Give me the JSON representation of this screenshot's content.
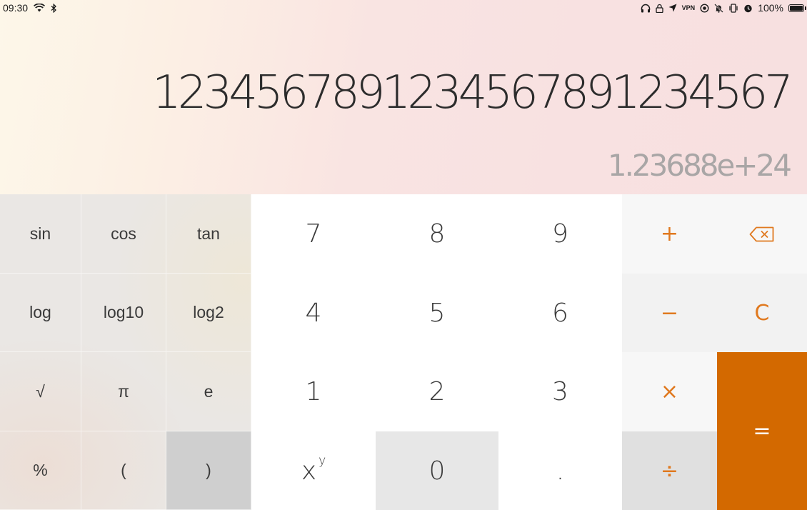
{
  "status_bar": {
    "time": "09:30",
    "battery": "100%",
    "vpn": "VPN"
  },
  "display": {
    "expression": "1234567891234567891234567",
    "result": "1.23688e+24"
  },
  "keys": {
    "sin": "sin",
    "cos": "cos",
    "tan": "tan",
    "log": "log",
    "log10": "log10",
    "log2": "log2",
    "sqrt": "√",
    "pi": "π",
    "e": "e",
    "percent": "%",
    "lparen": "(",
    "rparen": ")",
    "seven": "7",
    "eight": "8",
    "nine": "9",
    "four": "4",
    "five": "5",
    "six": "6",
    "one": "1",
    "two": "2",
    "three": "3",
    "power_base": "x",
    "power_exp": "y",
    "zero": "0",
    "decimal": ".",
    "plus": "+",
    "minus": "−",
    "multiply": "×",
    "divide": "÷",
    "clear": "C",
    "equals": "="
  },
  "colors": {
    "accent": "#e0791f",
    "equals_bg": "#d36900"
  }
}
